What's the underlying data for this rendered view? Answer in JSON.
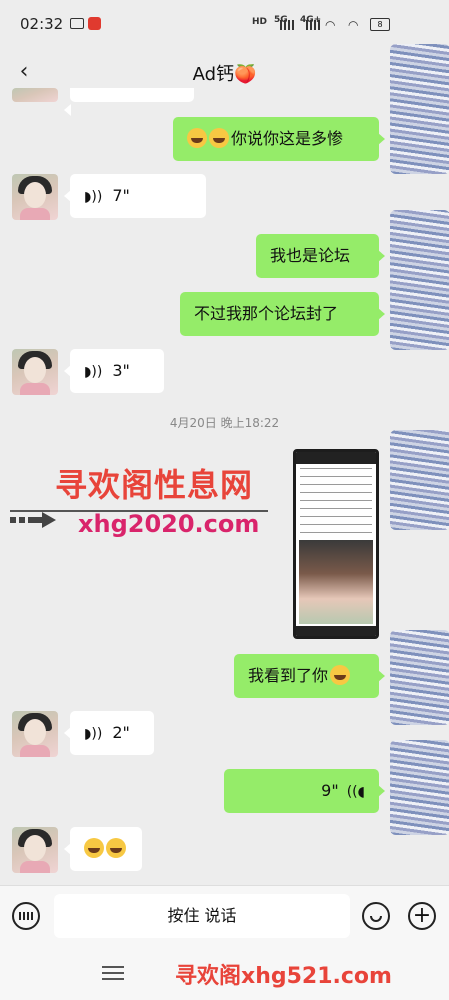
{
  "status_bar": {
    "time": "02:32",
    "network": "5G",
    "network2": "4G+",
    "battery": "8"
  },
  "header": {
    "back_icon": "chevron-left-icon",
    "title": "Ad钙🍑"
  },
  "messages": [
    {
      "side": "right",
      "type": "text",
      "text": "你说你这是多惨",
      "emoji_prefix": "😂😂"
    },
    {
      "side": "left",
      "type": "voice",
      "duration": "7\""
    },
    {
      "side": "right",
      "type": "text",
      "text": "我也是论坛"
    },
    {
      "side": "right",
      "type": "text",
      "text": "不过我那个论坛封了"
    },
    {
      "side": "left",
      "type": "voice",
      "duration": "3\""
    },
    {
      "type": "timestamp",
      "text": "4月20日 晚上18:22"
    },
    {
      "side": "right",
      "type": "image"
    },
    {
      "side": "right",
      "type": "text",
      "text": "我看到了你"
    },
    {
      "side": "left",
      "type": "voice",
      "duration": "2\""
    },
    {
      "side": "right",
      "type": "voice",
      "duration": "9\""
    },
    {
      "side": "left",
      "type": "emoji",
      "text": "😂😂"
    }
  ],
  "watermark": {
    "line1": "寻欢阁性息网",
    "line2": "xhg2020.com",
    "bottom": "寻欢阁xhg521.com"
  },
  "input_bar": {
    "hold_to_talk": "按住 说话"
  },
  "colors": {
    "sent_bubble": "#95ec69",
    "received_bubble": "#ffffff",
    "background": "#ededed",
    "watermark_red": "#e8443a"
  }
}
